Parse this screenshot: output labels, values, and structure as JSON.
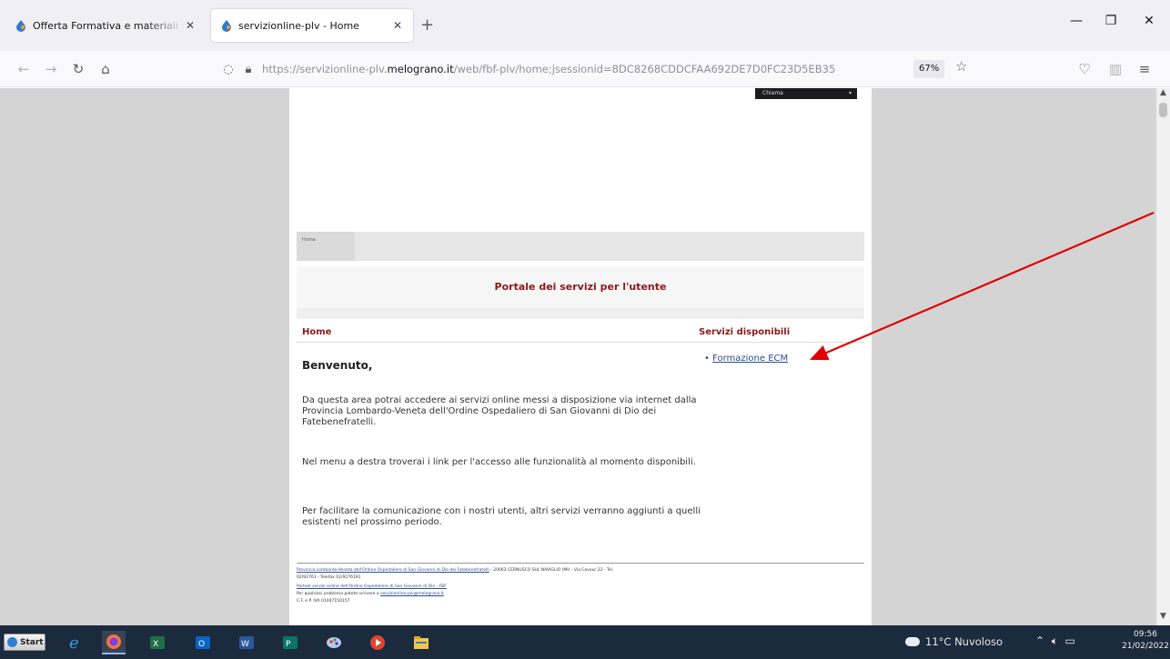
{
  "browser": {
    "tabs": [
      {
        "title": "Offerta Formativa e materiali u",
        "active": false
      },
      {
        "title": "servizionline-plv - Home",
        "active": true
      }
    ],
    "newtab_icon": "plus-icon",
    "url_prefix": "https://servizionline-plv.",
    "url_domain": "melograno.it",
    "url_suffix": "/web/fbf-plv/home;jsessionid=8DC8268CDDCFAA692DE7D0FC23D5EB35",
    "zoom": "67%"
  },
  "page": {
    "top_button": "Chiama",
    "breadcrumb": "Home",
    "portal_title": "Portale dei servizi per l'utente",
    "home_heading": "Home",
    "services_heading": "Servizi disponibili",
    "services": [
      {
        "label": "Formazione ECM"
      }
    ],
    "welcome": "Benvenuto,",
    "paragraphs": [
      "Da questa area potrai accedere ai servizi online messi a disposizione via internet dalla Provincia Lombardo-Veneta dell'Ordine Ospedaliero di San Giovanni di Dio dei Fatebenefratelli.",
      "Nel menu a destra troverai i link per l'accesso alle funzionalità al momento disponibili.",
      "Per facilitare la comunicazione con i nostri utenti, altri servizi verranno aggiunti a quelli esistenti nel prossimo periodo."
    ],
    "footer": {
      "line1_link": "Provincia Lombardo-Veneta dell'Ordine Ospedaliero di San Giovanni di Dio dei Fatebenefratelli",
      "line1_text": " - 20063 CERNUSCO SUL NAVIGLIO (MI) - Via Cavour 22 - Tel.",
      "line2": "02/92761 - Telefax 02/9276191",
      "line3_link": "Portale servizi online dell'Ordine Ospedaliero di San Giovanni di Dio - FBF",
      "line4_text": "Per qualsiasi problema potete scrivere a ",
      "line4_link": "servizionline-plv@melograno.it",
      "line5": "C.F. e P. IVA 01047150157"
    }
  },
  "taskbar": {
    "start_label": "Start",
    "weather": "11°C  Nuvoloso",
    "time": "09:56",
    "date": "21/02/2022"
  },
  "colors": {
    "accent_red": "#8b1a1a",
    "link_blue": "#2a4f8a",
    "annotation_arrow": "#e00000"
  }
}
